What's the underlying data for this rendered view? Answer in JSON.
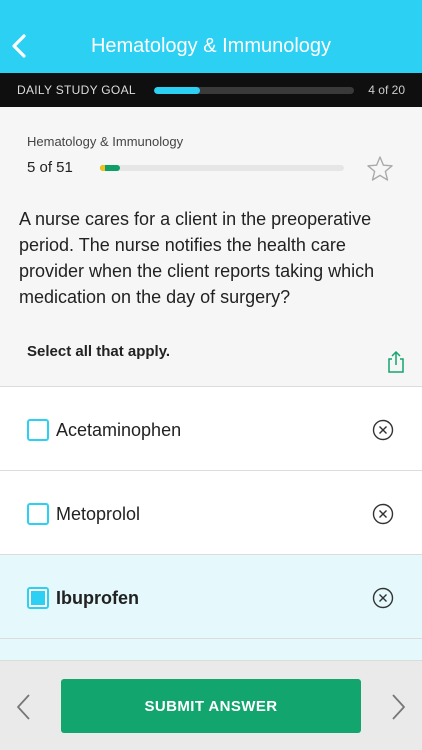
{
  "header": {
    "title": "Hematology & Immunology",
    "back_icon": "chevron-left-icon"
  },
  "goal": {
    "label": "DAILY STUDY GOAL",
    "count": "4 of 20",
    "progress": 0.23,
    "color": "#2cd0f2"
  },
  "question": {
    "subject": "Hematology & Immunology",
    "number": "5 of 51",
    "progress": 0.08,
    "text": "A nurse cares for a client in the preoperative period. The nurse notifies the health care provider when the client reports taking which medication on the day of surgery?",
    "instruction": "Select all that apply.",
    "bookmark_icon": "star-outline-icon",
    "share_icon": "share-icon"
  },
  "options": [
    {
      "label": "Acetaminophen",
      "checked": false
    },
    {
      "label": "Metoprolol",
      "checked": false
    },
    {
      "label": "Ibuprofen",
      "checked": true
    },
    {
      "label": "",
      "checked": false
    }
  ],
  "footer": {
    "submit_label": "SUBMIT ANSWER",
    "prev_icon": "chevron-left-icon",
    "next_icon": "chevron-right-icon",
    "submit_color": "#12a56e"
  }
}
